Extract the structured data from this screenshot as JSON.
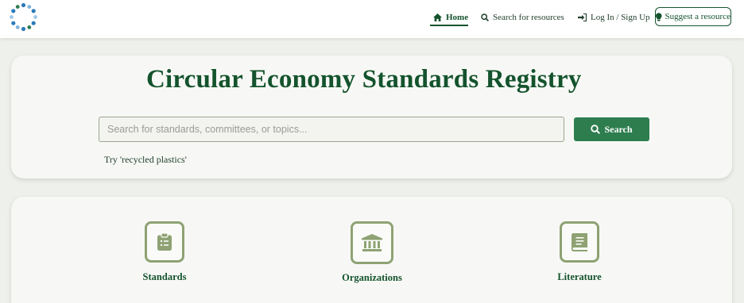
{
  "navbar": {
    "home_label": "Home",
    "search_label": "Search for resources",
    "login_label": "Log In / Sign Up",
    "suggest_label": "Suggest a resource"
  },
  "hero": {
    "title": "Circular Economy Standards Registry",
    "search_placeholder": "Search for standards, committees, or topics...",
    "search_button_label": "Search",
    "try_text": "Try 'recycled plastics'"
  },
  "categories": [
    {
      "label": "Standards",
      "icon": "clipboard-list-icon"
    },
    {
      "label": "Organizations",
      "icon": "institution-icon"
    },
    {
      "label": "Literature",
      "icon": "book-icon"
    }
  ],
  "colors": {
    "brand_dark_green": "#14532d",
    "button_green": "#2e7d4f",
    "icon_sage": "#8ea273",
    "page_background": "#eef0eb",
    "card_background": "#f7f8f5",
    "logo_blue": "#2b7bb9"
  }
}
